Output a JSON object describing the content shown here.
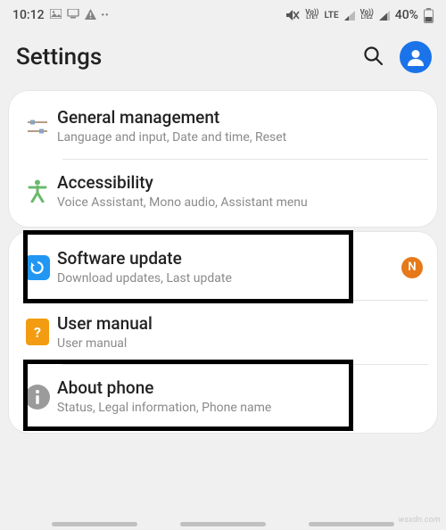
{
  "status_bar": {
    "time": "10:12",
    "battery_pct": "40%",
    "sim1_label_top": "Vo))",
    "sim1_label_bottom": "LTE1",
    "net1": "LTE",
    "sim2_label_top": "Vo))",
    "sim2_label_bottom": "LTE2",
    "net2": ""
  },
  "header": {
    "title": "Settings"
  },
  "groups": [
    {
      "rows": [
        {
          "title": "General management",
          "sub": "Language and input, Date and time, Reset"
        },
        {
          "title": "Accessibility",
          "sub": "Voice Assistant, Mono audio, Assistant menu"
        }
      ]
    },
    {
      "rows": [
        {
          "title": "Software update",
          "sub": "Download updates, Last update",
          "badge": "N"
        },
        {
          "title": "User manual",
          "sub": "User manual",
          "manual_icon": "?"
        },
        {
          "title": "About phone",
          "sub": "Status, Legal information, Phone name"
        }
      ]
    }
  ],
  "watermark": "wsxdn.com"
}
